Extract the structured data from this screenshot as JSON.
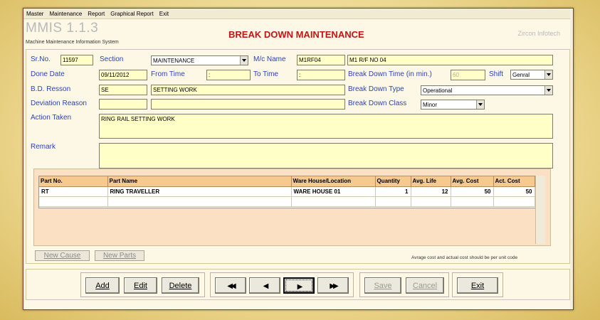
{
  "menu": [
    "Master",
    "Maintenance",
    "Report",
    "Graphical Report",
    "Exit"
  ],
  "app": {
    "name": "MMIS 1.1.3",
    "subtitle": "Machine Maintenance Information System",
    "company": "Zircon Infotech"
  },
  "form": {
    "title": "BREAK DOWN MAINTENANCE",
    "sr_no": {
      "label": "Sr.No.",
      "value": "11597"
    },
    "section": {
      "label": "Section",
      "value": "MAINTENANCE"
    },
    "mc_name": {
      "label": "M/c Name",
      "code": "M1RF04",
      "value": "M1 R/F NO 04"
    },
    "done_date": {
      "label": "Done Date",
      "value": "09/11/2012"
    },
    "from_time": {
      "label": "From Time",
      "value": ":"
    },
    "to_time": {
      "label": "To Time",
      "value": ":"
    },
    "break_down_time": {
      "label": "Break Down Time (in min.)",
      "value": "60"
    },
    "shift": {
      "label": "Shift",
      "value": "Genral"
    },
    "bd_reason": {
      "label": "B.D. Resson",
      "code": "SE",
      "value": "SETTING WORK"
    },
    "break_down_type": {
      "label": "Break Down Type",
      "value": "Operational"
    },
    "deviation_reason": {
      "label": "Deviation Reason",
      "code": "",
      "value": ""
    },
    "break_down_class": {
      "label": "Break Down Class",
      "value": "Minor"
    },
    "action_taken": {
      "label": "Action Taken",
      "value": "RING RAIL SETTING WORK"
    },
    "remark": {
      "label": "Remark",
      "value": ""
    }
  },
  "parts_grid": {
    "columns": [
      "Part No.",
      "Part Name",
      "Ware House/Location",
      "Quantity",
      "Avg. Life",
      "Avg. Cost",
      "Act. Cost"
    ],
    "rows": [
      [
        "RT",
        "RING TRAVELLER",
        "WARE HOUSE 01",
        "1",
        "12",
        "50",
        "50"
      ]
    ]
  },
  "buttons": {
    "new_cause": "New Cause",
    "new_parts": "New Parts",
    "note": "Avrage cost and actual cost should be per unit code",
    "add": "Add",
    "edit": "Edit",
    "delete": "Delete",
    "save": "Save",
    "cancel": "Cancel",
    "exit": "Exit"
  },
  "icons": {
    "first": "double-left-triangle",
    "prev": "left-triangle",
    "next": "right-triangle",
    "last": "double-right-triangle"
  },
  "colors": {
    "label": "#2c40c0",
    "title": "#c01515",
    "field_bg": "#ffffc8",
    "grid_header": "#f6c98e",
    "grid_bg": "#fbe0c4"
  }
}
